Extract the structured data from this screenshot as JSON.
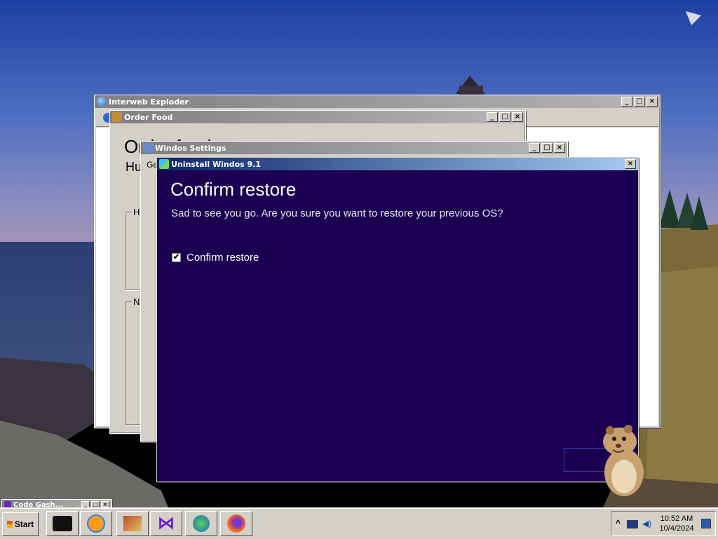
{
  "colors": {
    "dialog_bg": "#1b0052",
    "titlebar_active": "#0a246a",
    "titlebar_inactive": "#808080",
    "window_face": "#d4d0c8"
  },
  "windows": {
    "interweb": {
      "title": "Interweb Exploder",
      "icon": "globe-icon",
      "buttons": [
        "_",
        "□",
        "×"
      ]
    },
    "order_food": {
      "title": "Order Food",
      "icon": "food-icon",
      "heading": "Order food",
      "subheading": "Hu",
      "group1_label": "H",
      "group2_label": "Ne",
      "buttons": [
        "_",
        "□",
        "×"
      ]
    },
    "settings": {
      "title": "Windos Settings",
      "icon": "settings-icon",
      "tab_label": "Ge",
      "buttons": [
        "_",
        "□",
        "×"
      ]
    },
    "uninstall": {
      "title": "Uninstall Windos 9.1",
      "icon": "windows-icon",
      "heading": "Confirm restore",
      "message": "Sad to see you go. Are you sure you want to restore your previous OS?",
      "checkbox_label": "Confirm restore",
      "checkbox_checked": true,
      "close_label": "×"
    }
  },
  "minimized": {
    "title": "Code Gash...",
    "buttons": [
      "_",
      "□",
      "×"
    ]
  },
  "taskbar": {
    "start_label": "Start",
    "quick_launch": [
      "terminal-icon",
      "media-player-icon",
      "image-viewer-icon",
      "visual-studio-icon",
      "download-manager-icon",
      "firefox-icon"
    ],
    "tray": {
      "chevron": "^",
      "time": "10:52 AM",
      "date": "10/4/2024"
    }
  }
}
